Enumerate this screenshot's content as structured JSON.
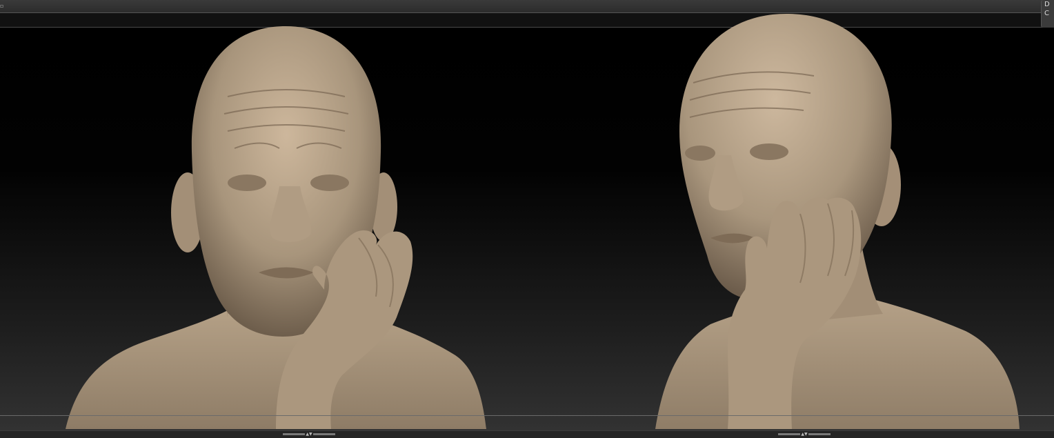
{
  "right_panel": {
    "line1": "D",
    "line2": "C"
  },
  "colors": {
    "skin": "#b9a58c",
    "skin_shadow": "#7d6b57",
    "background": "#000000",
    "chrome": "#2c2c2c"
  },
  "viewport": {
    "subject": "sculpt",
    "views": [
      "front-view",
      "three-quarter-view"
    ]
  },
  "icons": {
    "scroll_arrows": "up-down-arrows-icon"
  }
}
